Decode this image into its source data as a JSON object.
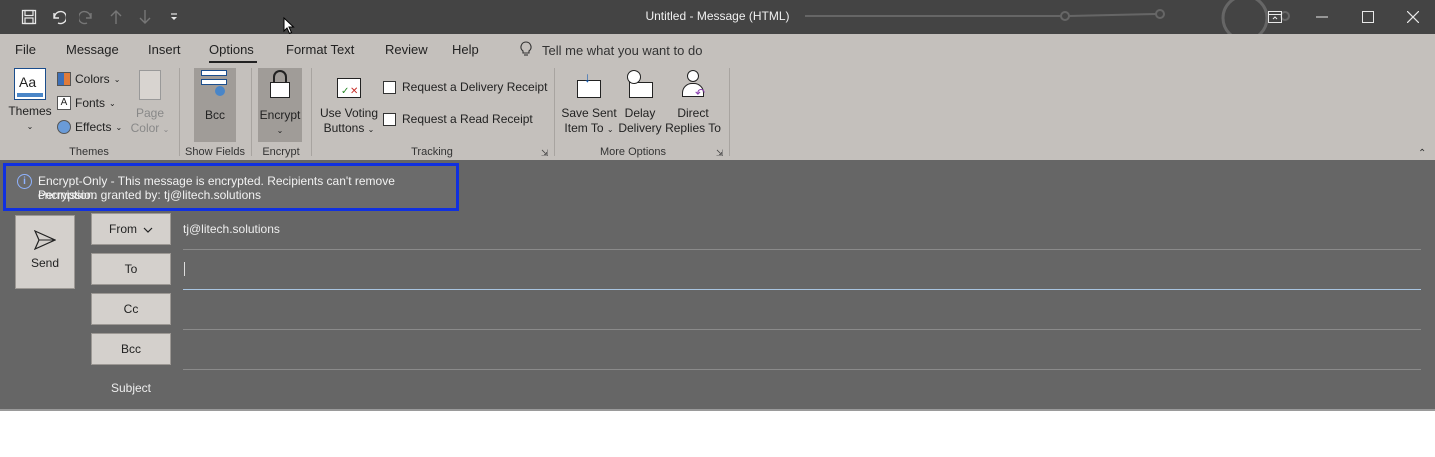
{
  "window": {
    "title": "Untitled  -  Message (HTML)"
  },
  "tabs": [
    "File",
    "Message",
    "Insert",
    "Options",
    "Format Text",
    "Review",
    "Help"
  ],
  "active_tab": "Options",
  "tell_me": "Tell me what you want to do",
  "ribbon": {
    "themes": {
      "themes_label": "Themes",
      "colors_label": "Colors",
      "fonts_label": "Fonts",
      "effects_label": "Effects",
      "page_color_line1": "Page",
      "page_color_line2": "Color",
      "group_label": "Themes"
    },
    "show_fields": {
      "bcc_label": "Bcc",
      "group_label": "Show Fields"
    },
    "encrypt": {
      "encrypt_label": "Encrypt",
      "group_label": "Encrypt"
    },
    "tracking": {
      "voting_line1": "Use Voting",
      "voting_line2": "Buttons",
      "delivery_receipt": "Request a Delivery Receipt",
      "read_receipt": "Request a Read Receipt",
      "group_label": "Tracking"
    },
    "more_options": {
      "save_sent_line1": "Save Sent",
      "save_sent_line2": "Item To",
      "delay_line1": "Delay",
      "delay_line2": "Delivery",
      "direct_line1": "Direct",
      "direct_line2": "Replies To",
      "group_label": "More Options"
    }
  },
  "infobar": {
    "line1": "Encrypt-Only - This message is encrypted. Recipients can't remove encryption.",
    "line2": "Permission granted by: tj@litech.solutions"
  },
  "compose": {
    "send_label": "Send",
    "from_label": "From",
    "from_value": "tj@litech.solutions",
    "to_label": "To",
    "cc_label": "Cc",
    "bcc_label": "Bcc",
    "subject_label": "Subject"
  },
  "colors": {
    "titlebar": "#444444",
    "ribbon": "#c4c0bc",
    "compose_bg": "#666666",
    "highlight_border": "#1030e0"
  }
}
